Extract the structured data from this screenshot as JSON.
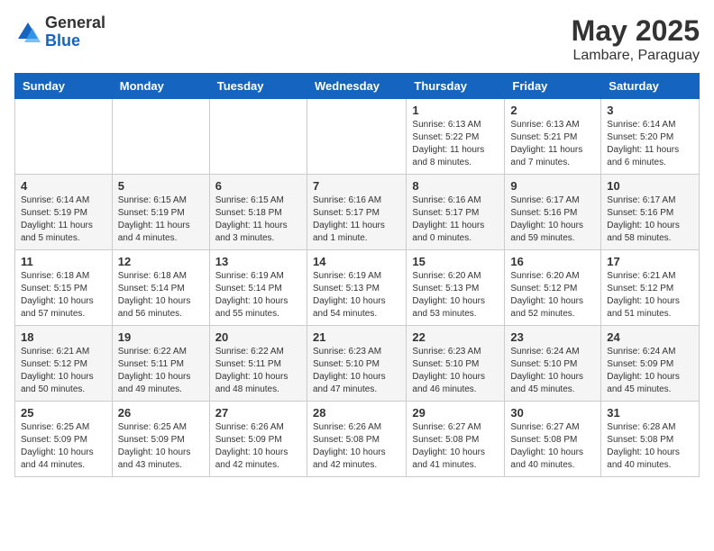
{
  "logo": {
    "general": "General",
    "blue": "Blue"
  },
  "title": {
    "month_year": "May 2025",
    "location": "Lambare, Paraguay"
  },
  "weekdays": [
    "Sunday",
    "Monday",
    "Tuesday",
    "Wednesday",
    "Thursday",
    "Friday",
    "Saturday"
  ],
  "weeks": [
    [
      {
        "day": "",
        "info": ""
      },
      {
        "day": "",
        "info": ""
      },
      {
        "day": "",
        "info": ""
      },
      {
        "day": "",
        "info": ""
      },
      {
        "day": "1",
        "info": "Sunrise: 6:13 AM\nSunset: 5:22 PM\nDaylight: 11 hours\nand 8 minutes."
      },
      {
        "day": "2",
        "info": "Sunrise: 6:13 AM\nSunset: 5:21 PM\nDaylight: 11 hours\nand 7 minutes."
      },
      {
        "day": "3",
        "info": "Sunrise: 6:14 AM\nSunset: 5:20 PM\nDaylight: 11 hours\nand 6 minutes."
      }
    ],
    [
      {
        "day": "4",
        "info": "Sunrise: 6:14 AM\nSunset: 5:19 PM\nDaylight: 11 hours\nand 5 minutes."
      },
      {
        "day": "5",
        "info": "Sunrise: 6:15 AM\nSunset: 5:19 PM\nDaylight: 11 hours\nand 4 minutes."
      },
      {
        "day": "6",
        "info": "Sunrise: 6:15 AM\nSunset: 5:18 PM\nDaylight: 11 hours\nand 3 minutes."
      },
      {
        "day": "7",
        "info": "Sunrise: 6:16 AM\nSunset: 5:17 PM\nDaylight: 11 hours\nand 1 minute."
      },
      {
        "day": "8",
        "info": "Sunrise: 6:16 AM\nSunset: 5:17 PM\nDaylight: 11 hours\nand 0 minutes."
      },
      {
        "day": "9",
        "info": "Sunrise: 6:17 AM\nSunset: 5:16 PM\nDaylight: 10 hours\nand 59 minutes."
      },
      {
        "day": "10",
        "info": "Sunrise: 6:17 AM\nSunset: 5:16 PM\nDaylight: 10 hours\nand 58 minutes."
      }
    ],
    [
      {
        "day": "11",
        "info": "Sunrise: 6:18 AM\nSunset: 5:15 PM\nDaylight: 10 hours\nand 57 minutes."
      },
      {
        "day": "12",
        "info": "Sunrise: 6:18 AM\nSunset: 5:14 PM\nDaylight: 10 hours\nand 56 minutes."
      },
      {
        "day": "13",
        "info": "Sunrise: 6:19 AM\nSunset: 5:14 PM\nDaylight: 10 hours\nand 55 minutes."
      },
      {
        "day": "14",
        "info": "Sunrise: 6:19 AM\nSunset: 5:13 PM\nDaylight: 10 hours\nand 54 minutes."
      },
      {
        "day": "15",
        "info": "Sunrise: 6:20 AM\nSunset: 5:13 PM\nDaylight: 10 hours\nand 53 minutes."
      },
      {
        "day": "16",
        "info": "Sunrise: 6:20 AM\nSunset: 5:12 PM\nDaylight: 10 hours\nand 52 minutes."
      },
      {
        "day": "17",
        "info": "Sunrise: 6:21 AM\nSunset: 5:12 PM\nDaylight: 10 hours\nand 51 minutes."
      }
    ],
    [
      {
        "day": "18",
        "info": "Sunrise: 6:21 AM\nSunset: 5:12 PM\nDaylight: 10 hours\nand 50 minutes."
      },
      {
        "day": "19",
        "info": "Sunrise: 6:22 AM\nSunset: 5:11 PM\nDaylight: 10 hours\nand 49 minutes."
      },
      {
        "day": "20",
        "info": "Sunrise: 6:22 AM\nSunset: 5:11 PM\nDaylight: 10 hours\nand 48 minutes."
      },
      {
        "day": "21",
        "info": "Sunrise: 6:23 AM\nSunset: 5:10 PM\nDaylight: 10 hours\nand 47 minutes."
      },
      {
        "day": "22",
        "info": "Sunrise: 6:23 AM\nSunset: 5:10 PM\nDaylight: 10 hours\nand 46 minutes."
      },
      {
        "day": "23",
        "info": "Sunrise: 6:24 AM\nSunset: 5:10 PM\nDaylight: 10 hours\nand 45 minutes."
      },
      {
        "day": "24",
        "info": "Sunrise: 6:24 AM\nSunset: 5:09 PM\nDaylight: 10 hours\nand 45 minutes."
      }
    ],
    [
      {
        "day": "25",
        "info": "Sunrise: 6:25 AM\nSunset: 5:09 PM\nDaylight: 10 hours\nand 44 minutes."
      },
      {
        "day": "26",
        "info": "Sunrise: 6:25 AM\nSunset: 5:09 PM\nDaylight: 10 hours\nand 43 minutes."
      },
      {
        "day": "27",
        "info": "Sunrise: 6:26 AM\nSunset: 5:09 PM\nDaylight: 10 hours\nand 42 minutes."
      },
      {
        "day": "28",
        "info": "Sunrise: 6:26 AM\nSunset: 5:08 PM\nDaylight: 10 hours\nand 42 minutes."
      },
      {
        "day": "29",
        "info": "Sunrise: 6:27 AM\nSunset: 5:08 PM\nDaylight: 10 hours\nand 41 minutes."
      },
      {
        "day": "30",
        "info": "Sunrise: 6:27 AM\nSunset: 5:08 PM\nDaylight: 10 hours\nand 40 minutes."
      },
      {
        "day": "31",
        "info": "Sunrise: 6:28 AM\nSunset: 5:08 PM\nDaylight: 10 hours\nand 40 minutes."
      }
    ]
  ]
}
